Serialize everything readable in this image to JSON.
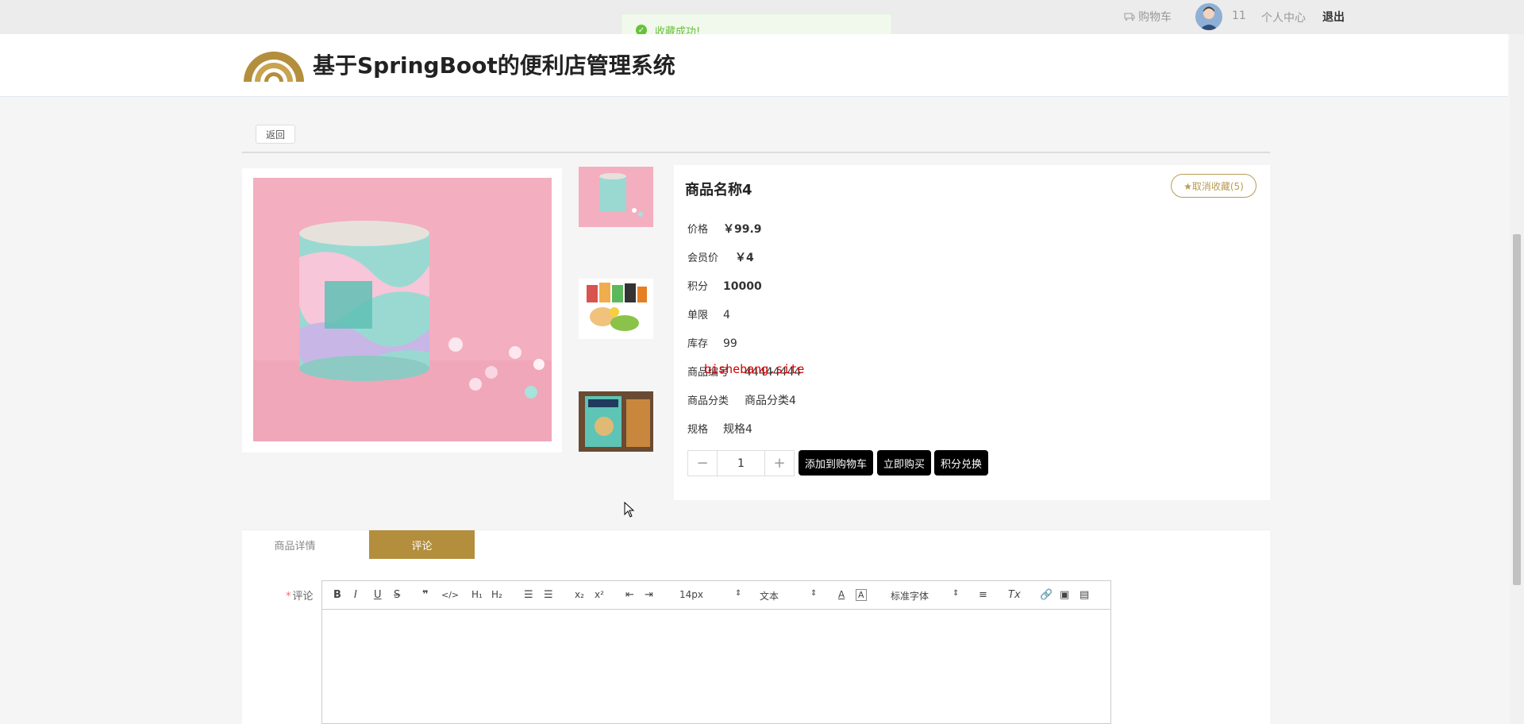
{
  "topbar": {
    "cart_label": "购物车",
    "username": "11",
    "personal_center": "个人中心",
    "logout": "退出"
  },
  "toast": {
    "message": "收藏成功!"
  },
  "header": {
    "title": "基于SpringBoot的便利店管理系统"
  },
  "back_label": "返回",
  "product": {
    "name": "商品名称4",
    "favorite_label": "★取消收藏(5)",
    "fields": [
      {
        "label": "价格",
        "value": "￥99.9"
      },
      {
        "label": "会员价",
        "value": "￥4"
      },
      {
        "label": "积分",
        "value": "10000"
      },
      {
        "label": "单限",
        "value": "4"
      },
      {
        "label": "库存",
        "value": "99"
      },
      {
        "label": "商品编号",
        "value": "44444444"
      },
      {
        "label": "商品分类",
        "value": "商品分类4"
      },
      {
        "label": "规格",
        "value": "规格4"
      }
    ],
    "quantity": "1",
    "add_cart": "添加到购物车",
    "buy_now": "立即购买",
    "points_exchange": "积分兑换"
  },
  "watermark": "bishebang.site",
  "tabs": [
    {
      "label": "商品详情",
      "active": false
    },
    {
      "label": "评论",
      "active": true
    }
  ],
  "comment": {
    "label": "评论",
    "required_mark": "*",
    "font_size": "14px",
    "text_type": "文本",
    "font_family": "标准字体"
  },
  "colors": {
    "accent": "#b38e3c",
    "success": "#67c23a",
    "button": "#000000"
  }
}
